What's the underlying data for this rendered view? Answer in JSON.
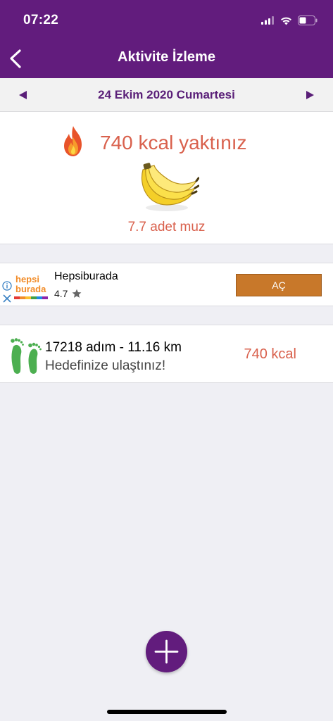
{
  "status_bar": {
    "time": "07:22",
    "icons": [
      "signal-icon",
      "wifi-icon",
      "battery-icon"
    ]
  },
  "nav": {
    "title": "Aktivite İzleme",
    "back_icon": "chevron-left-icon"
  },
  "date_bar": {
    "date": "24 Ekim 2020 Cumartesi",
    "prev_icon": "triangle-left-icon",
    "next_icon": "triangle-right-icon"
  },
  "summary": {
    "burned": "740 kcal yaktınız",
    "equivalent": "7.7 adet muz",
    "icons": [
      "flame-icon",
      "banana-icon"
    ]
  },
  "ad": {
    "brand_logo_line1": "hepsi",
    "brand_logo_line2": "burada",
    "name": "Hepsiburada",
    "rating": "4.7",
    "button": "AÇ"
  },
  "activity": {
    "steps_line": "17218 adım - 11.16 km",
    "goal_line": "Hedefinize ulaştınız!",
    "kcal": "740 kcal"
  },
  "fab": {
    "icon": "plus-icon"
  },
  "colors": {
    "primary": "#621c7d",
    "accent_text": "#d9614d",
    "ad_button": "#c8782a",
    "feet": "#4caf50"
  }
}
